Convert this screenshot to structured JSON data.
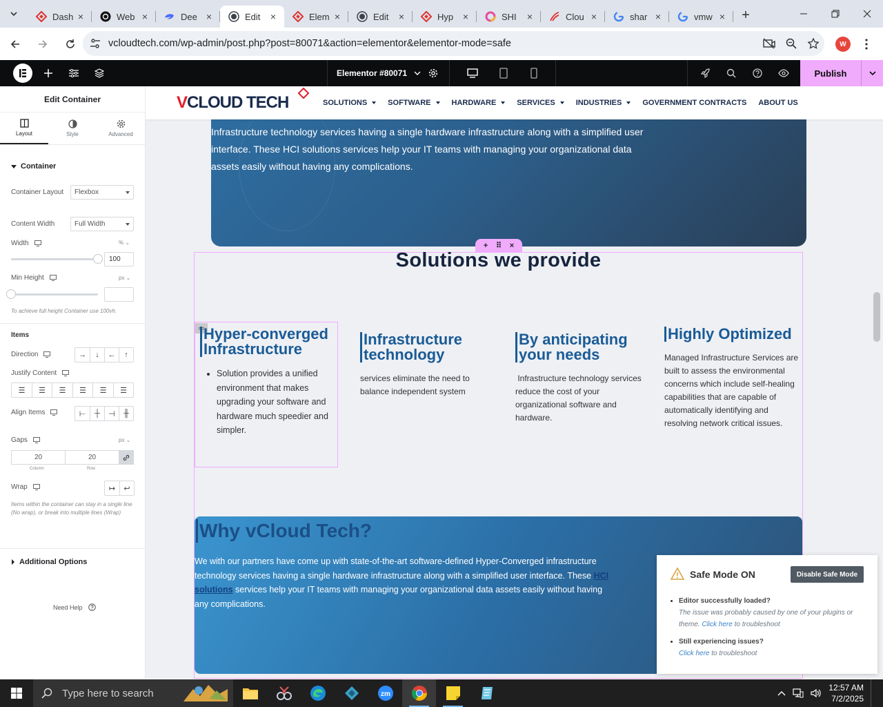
{
  "browser": {
    "tabs": [
      {
        "label": "Dash",
        "icon": "elementor-diamond-icon",
        "active": false
      },
      {
        "label": "Web",
        "icon": "openai-icon",
        "active": false
      },
      {
        "label": "Dee",
        "icon": "deepseek-icon",
        "active": false
      },
      {
        "label": "Edit",
        "icon": "wordpress-icon",
        "active": true
      },
      {
        "label": "Elem",
        "icon": "elementor-diamond-icon",
        "active": false
      },
      {
        "label": "Edit",
        "icon": "wordpress-icon",
        "active": false
      },
      {
        "label": "Hyp",
        "icon": "elementor-diamond-icon",
        "active": false
      },
      {
        "label": "SHI",
        "icon": "circle-logo-icon",
        "active": false
      },
      {
        "label": "Clou",
        "icon": "swirl-logo-icon",
        "active": false
      },
      {
        "label": "shar",
        "icon": "google-icon",
        "active": false
      },
      {
        "label": "vmw",
        "icon": "google-icon",
        "active": false
      }
    ],
    "url": "vcloudtech.com/wp-admin/post.php?post=80071&action=elementor&elementor-mode=safe",
    "profile_initial": "W"
  },
  "editor": {
    "document_title": "Elementor #80071",
    "publish_label": "Publish"
  },
  "panel": {
    "title": "Edit Container",
    "tabs": [
      "Layout",
      "Style",
      "Advanced"
    ],
    "section_container": "Container",
    "container_layout_label": "Container Layout",
    "container_layout_value": "Flexbox",
    "content_width_label": "Content Width",
    "content_width_value": "Full Width",
    "width_label": "Width",
    "width_unit": "%",
    "width_value": "100",
    "width_fraction": 1.0,
    "min_height_label": "Min Height",
    "min_height_unit": "px",
    "min_height_value": "",
    "min_height_hint": "To achieve full height Container use 100vh.",
    "items_heading": "Items",
    "direction_label": "Direction",
    "justify_label": "Justify Content",
    "align_label": "Align Items",
    "gaps_label": "Gaps",
    "gaps_unit": "px",
    "gap_column": "20",
    "gap_row": "20",
    "gap_column_label": "Column",
    "gap_row_label": "Row",
    "wrap_label": "Wrap",
    "wrap_hint": "Items within the container can stay in a single line (No wrap), or break into multiple lines (Wrap)",
    "additional_options": "Additional Options",
    "need_help": "Need Help"
  },
  "site": {
    "logo_a": "V",
    "logo_b": "CLOUD TECH",
    "nav": [
      {
        "label": "SOLUTIONS",
        "dropdown": true
      },
      {
        "label": "SOFTWARE",
        "dropdown": true
      },
      {
        "label": "HARDWARE",
        "dropdown": true
      },
      {
        "label": "SERVICES",
        "dropdown": true
      },
      {
        "label": "INDUSTRIES",
        "dropdown": true
      },
      {
        "label": "GOVERNMENT CONTRACTS",
        "dropdown": false
      },
      {
        "label": "ABOUT US",
        "dropdown": false
      }
    ],
    "hero_text": "Infrastructure technology services having a single hardware infrastructure along with a simplified user interface. These HCI solutions services help your IT teams with managing your organizational data assets easily without having any complications.",
    "solutions_title": "Solutions we provide",
    "columns": [
      {
        "title": "Hyper-converged Infrastructure",
        "bullet": "Solution provides a unified environment that makes upgrading your software and hardware much speedier and simpler."
      },
      {
        "title": "Infrastructure technology",
        "text": "services eliminate the need to balance independent system"
      },
      {
        "title": "By anticipating your needs",
        "text": " Infrastructure technology services reduce the cost of your organizational software and hardware."
      },
      {
        "title": "Highly Optimized",
        "text": "Managed Infrastructure Services are built to assess the environmental concerns which include self-healing capabilities that are capable of automatically identifying and resolving network critical issues."
      }
    ],
    "why_title": "Why vCloud Tech?",
    "why_text_1": "We with our partners have come up with state-of-the-art software-defined Hyper-Converged infrastructure technology services having a single hardware infrastructure along with a simplified user interface. These ",
    "why_link": "HCI solutions",
    "why_text_2": " services help your IT teams with managing your organizational data assets easily without having any complications."
  },
  "safe_mode": {
    "title": "Safe Mode ON",
    "button": "Disable Safe Mode",
    "item1_title": "Editor successfully loaded?",
    "item1_text": "The issue was probably caused by one of your plugins or theme. ",
    "item1_link": "Click here",
    "item1_tail": " to troubleshoot",
    "item2_title": "Still experiencing issues?",
    "item2_link": "Click here",
    "item2_tail": " to troubleshoot"
  },
  "taskbar": {
    "search_placeholder": "Type here to search",
    "time": "12:57 AM",
    "date": "7/2/2025"
  },
  "colors": {
    "accent_pink": "#f0abfc",
    "heading_blue": "#1a5b96",
    "navy": "#16243d"
  }
}
